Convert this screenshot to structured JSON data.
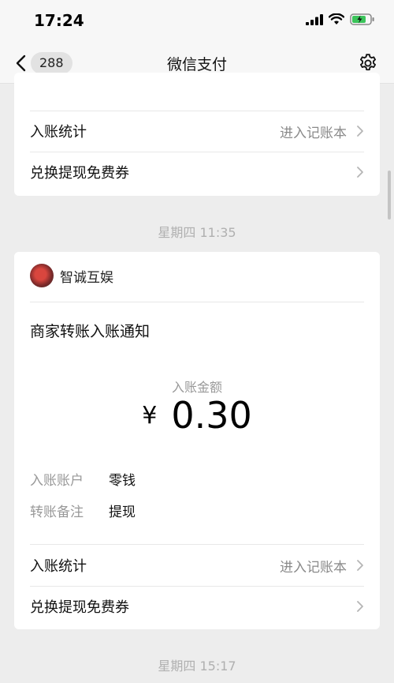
{
  "status_bar": {
    "time": "17:24"
  },
  "nav": {
    "back_count": "288",
    "title": "微信支付"
  },
  "card1": {
    "row1": {
      "label": "入账统计",
      "action": "进入记账本"
    },
    "row2": {
      "label": "兑换提现免费券"
    }
  },
  "dates": {
    "first": "星期四 11:35",
    "second": "星期四 15:17"
  },
  "card2": {
    "merchant": "智诚互娱",
    "title": "商家转账入账通知",
    "amount_label": "入账金额",
    "currency": "¥",
    "amount": "0.30",
    "details": [
      {
        "key": "入账账户",
        "value": "零钱"
      },
      {
        "key": "转账备注",
        "value": "提现"
      }
    ],
    "row1": {
      "label": "入账统计",
      "action": "进入记账本"
    },
    "row2": {
      "label": "兑换提现免费券"
    }
  }
}
